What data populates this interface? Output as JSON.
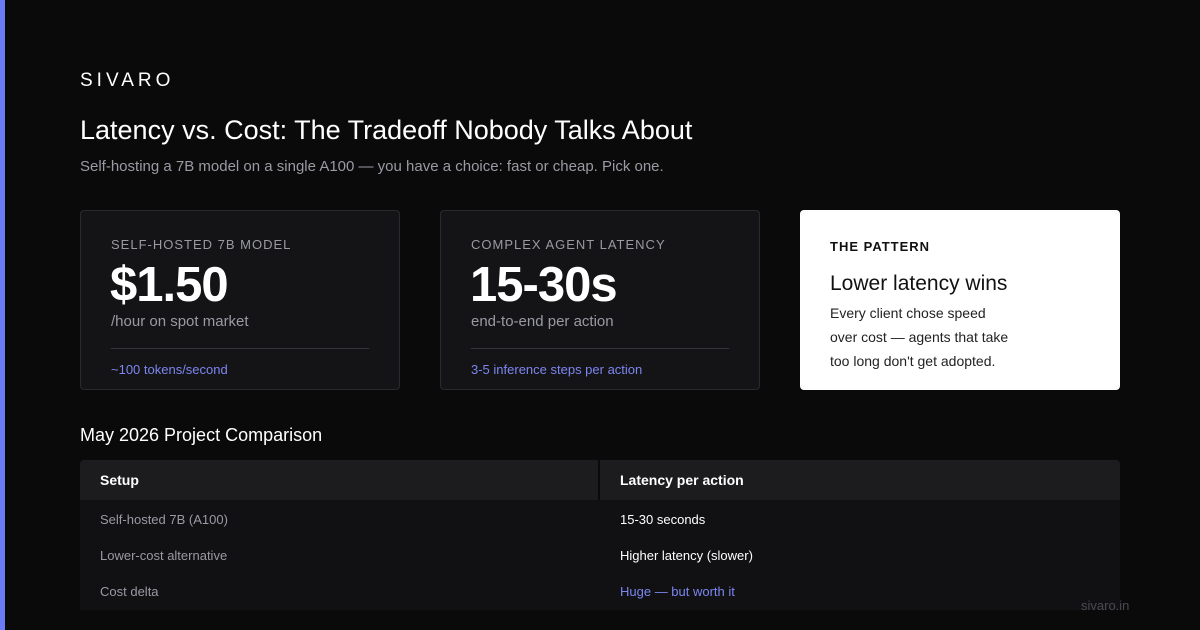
{
  "brand": "SIVARO",
  "title": "Latency vs. Cost: The Tradeoff Nobody Talks About",
  "subtitle": "Self-hosting a 7B model on a single A100 — you have a choice: fast or cheap. Pick one.",
  "cards": [
    {
      "kicker": "SELF-HOSTED 7B MODEL",
      "value": "$1.50",
      "unit": "/hour on spot market",
      "note": "~100 tokens/second"
    },
    {
      "kicker": "COMPLEX AGENT LATENCY",
      "value": "15-30s",
      "unit": "end-to-end per action",
      "note": "3-5 inference steps per action"
    }
  ],
  "pattern": {
    "kicker": "THE PATTERN",
    "headline": "Lower latency wins",
    "body": "Every client chose speed over cost — agents that take too long don't get adopted."
  },
  "comparison": {
    "title": "May 2026 Project Comparison",
    "headers": [
      "Setup",
      "Latency per action"
    ],
    "rows": [
      [
        "Self-hosted 7B (A100)",
        "15-30 seconds"
      ],
      [
        "Lower-cost alternative",
        "Higher latency (slower)"
      ],
      [
        "Cost delta",
        "Huge — but worth it"
      ]
    ]
  },
  "site": "sivaro.in",
  "colors": {
    "accent": "#6b7bf7",
    "background": "#0a0a0b",
    "card": "#141416",
    "highlight": "#7c86f0"
  }
}
